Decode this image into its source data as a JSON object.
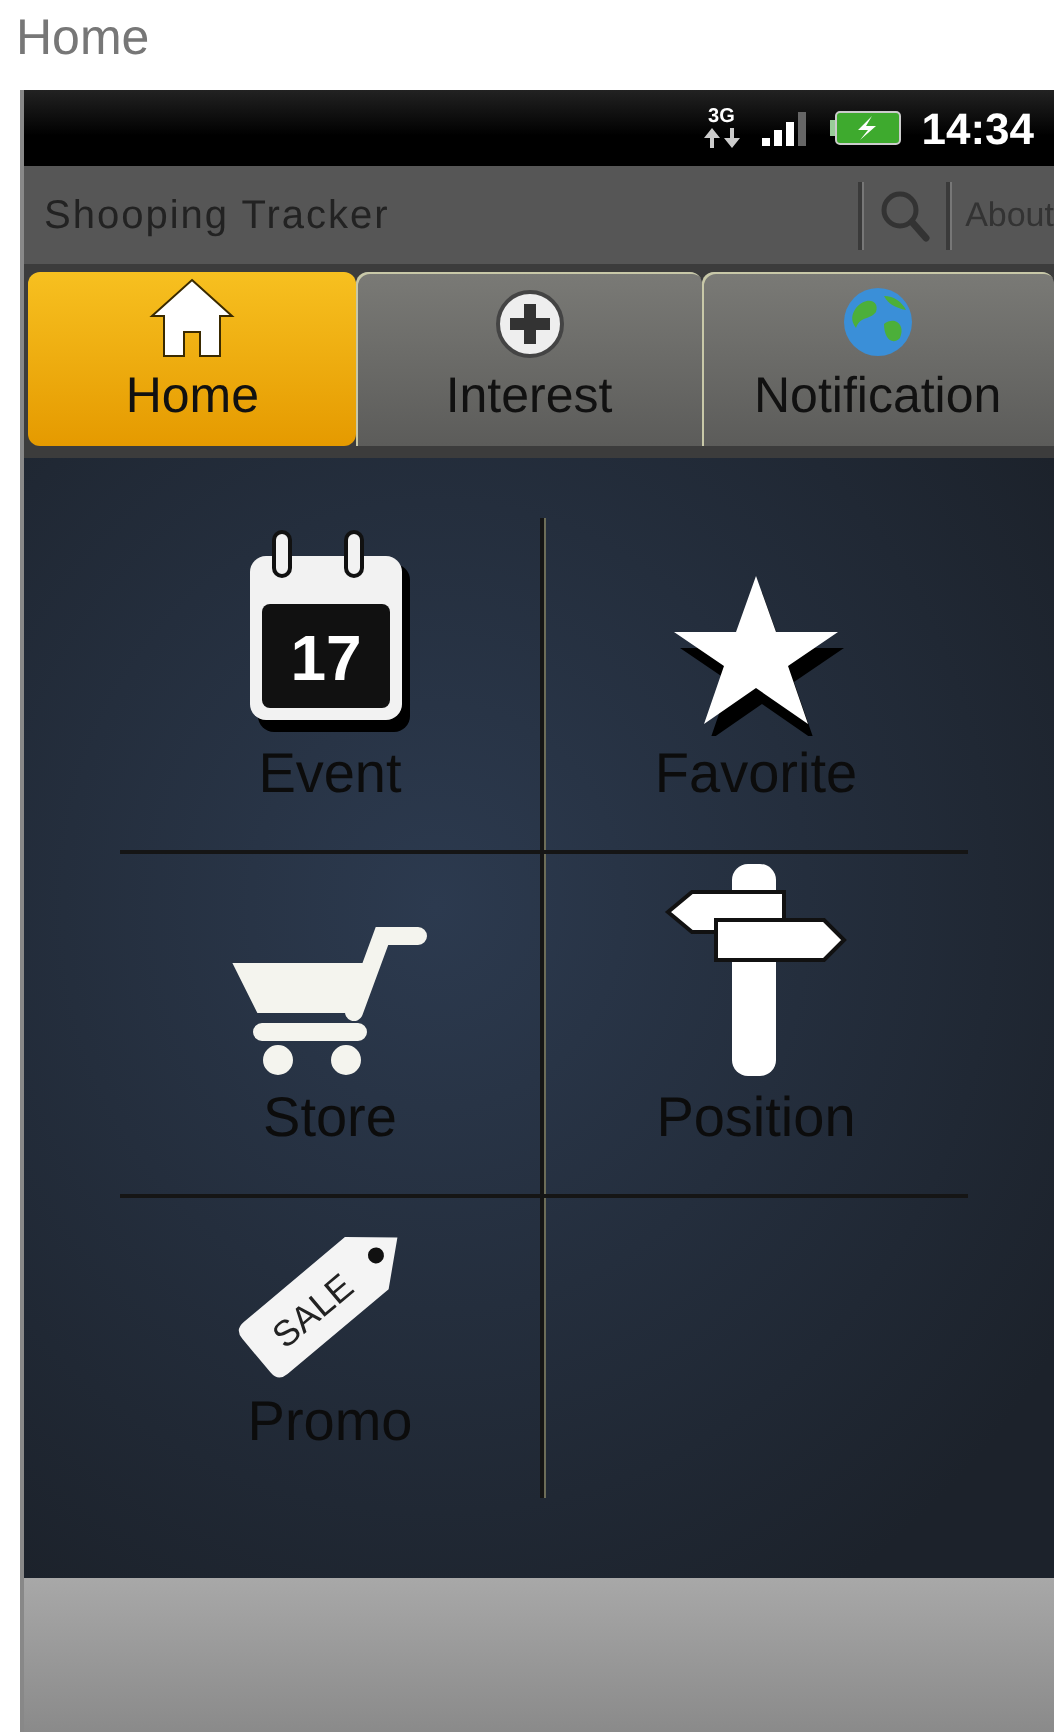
{
  "page_title": "Home",
  "status_bar": {
    "network": "3G",
    "time": "14:34"
  },
  "app_bar": {
    "title": "Shooping Tracker",
    "action": "About"
  },
  "tabs": [
    {
      "label": "Home",
      "kind": "house",
      "selected": true
    },
    {
      "label": "Interest",
      "kind": "plus",
      "selected": false
    },
    {
      "label": "Notification",
      "kind": "globe",
      "selected": false
    }
  ],
  "menu": [
    {
      "label": "Event",
      "kind": "calendar",
      "icon_text": "17"
    },
    {
      "label": "Favorite",
      "kind": "star"
    },
    {
      "label": "Store",
      "kind": "cart"
    },
    {
      "label": "Position",
      "kind": "signpost"
    },
    {
      "label": "Promo",
      "kind": "tag",
      "icon_text": "SALE"
    }
  ]
}
